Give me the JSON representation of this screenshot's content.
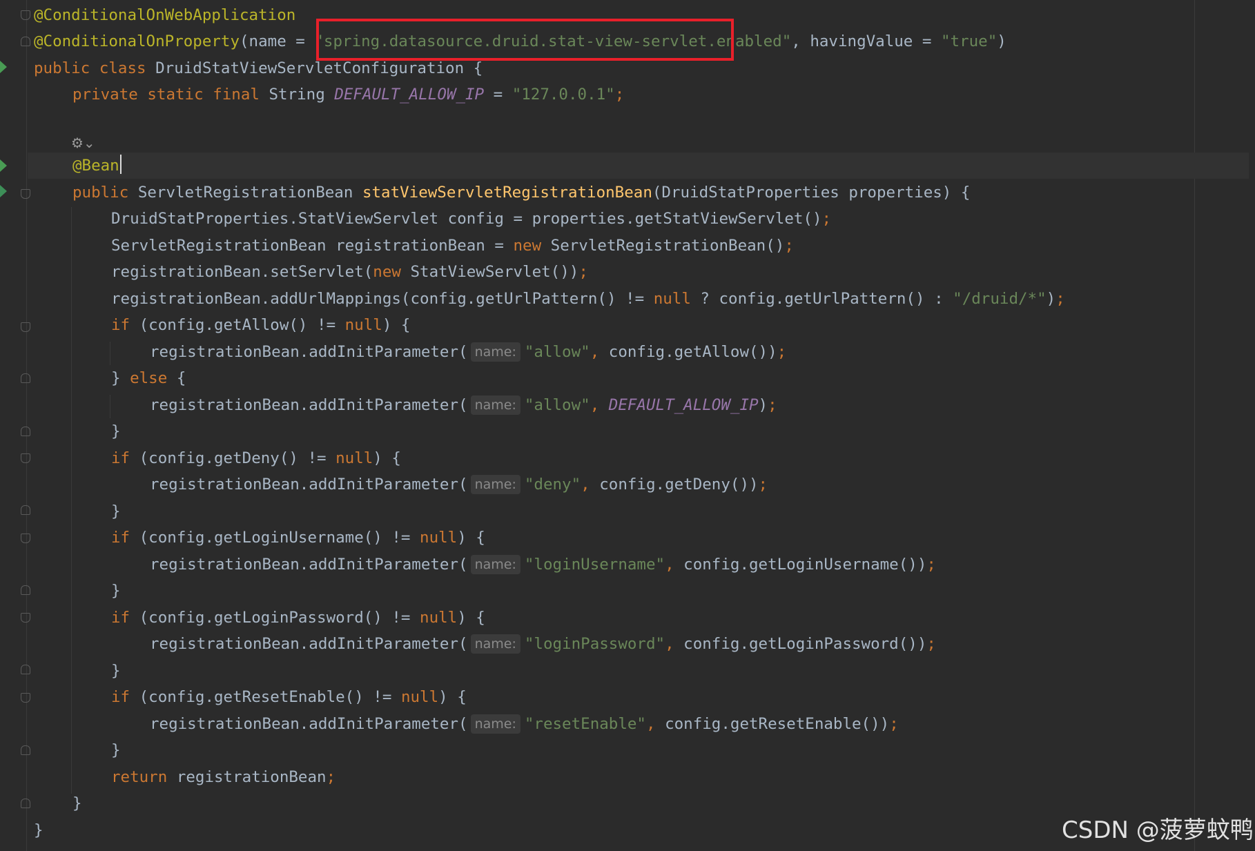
{
  "colors": {
    "background": "#2b2b2b",
    "keyword": "#cc7832",
    "annotation": "#bbb529",
    "string": "#6a8759",
    "constant": "#9876aa",
    "method_decl": "#ffc66d",
    "text": "#a9b7c6",
    "highlight_box": "#e8202a"
  },
  "hint_label": "name:",
  "watermark": "CSDN @菠萝蚊鸭",
  "code": {
    "l1": [
      "@ConditionalOnWebApplication"
    ],
    "l2": [
      "@ConditionalOnProperty",
      "(name = ",
      "\"spring.datasource.druid.stat-view-servlet.enabled\"",
      ", havingValue = ",
      "\"true\"",
      ")"
    ],
    "l3": [
      "public class",
      " DruidStatViewServletConfiguration {"
    ],
    "l4": [
      "private static final",
      " String ",
      "DEFAULT_ALLOW_IP",
      " = ",
      "\"127.0.0.1\"",
      ";"
    ],
    "l6": [
      "@Bean"
    ],
    "l7": [
      "public",
      " ServletRegistrationBean ",
      "statViewServletRegistrationBean",
      "(DruidStatProperties properties) {"
    ],
    "l8": [
      "DruidStatProperties.StatViewServlet config = properties.getStatViewServlet()",
      ";"
    ],
    "l9": [
      "ServletRegistrationBean registrationBean = ",
      "new",
      " ServletRegistrationBean()",
      ";"
    ],
    "l10": [
      "registrationBean.setServlet(",
      "new",
      " StatViewServlet())",
      ";"
    ],
    "l11": [
      "registrationBean.addUrlMappings(config.getUrlPattern() != ",
      "null",
      " ? config.getUrlPattern() : ",
      "\"/druid/*\"",
      ")",
      ";"
    ],
    "l12": [
      "if",
      " (config.getAllow() != ",
      "null",
      ") {"
    ],
    "l13": [
      "registrationBean.addInitParameter(",
      "\"allow\"",
      ",",
      " config.getAllow())",
      ";"
    ],
    "l14": [
      "} ",
      "else",
      " {"
    ],
    "l15": [
      "registrationBean.addInitParameter(",
      "\"allow\"",
      ",",
      " ",
      "DEFAULT_ALLOW_IP",
      ")",
      ";"
    ],
    "l16": [
      "}"
    ],
    "l17": [
      "if",
      " (config.getDeny() != ",
      "null",
      ") {"
    ],
    "l18": [
      "registrationBean.addInitParameter(",
      "\"deny\"",
      ",",
      " config.getDeny())",
      ";"
    ],
    "l19": [
      "}"
    ],
    "l20": [
      "if",
      " (config.getLoginUsername() != ",
      "null",
      ") {"
    ],
    "l21": [
      "registrationBean.addInitParameter(",
      "\"loginUsername\"",
      ",",
      " config.getLoginUsername())",
      ";"
    ],
    "l22": [
      "}"
    ],
    "l23": [
      "if",
      " (config.getLoginPassword() != ",
      "null",
      ") {"
    ],
    "l24": [
      "registrationBean.addInitParameter(",
      "\"loginPassword\"",
      ",",
      " config.getLoginPassword())",
      ";"
    ],
    "l25": [
      "}"
    ],
    "l26": [
      "if",
      " (config.getResetEnable() != ",
      "null",
      ") {"
    ],
    "l27": [
      "registrationBean.addInitParameter(",
      "\"resetEnable\"",
      ",",
      " config.getResetEnable())",
      ";"
    ],
    "l28": [
      "}"
    ],
    "l29": [
      "return",
      " registrationBean",
      ";"
    ],
    "l30": [
      "}"
    ],
    "l31": [
      "}"
    ]
  }
}
